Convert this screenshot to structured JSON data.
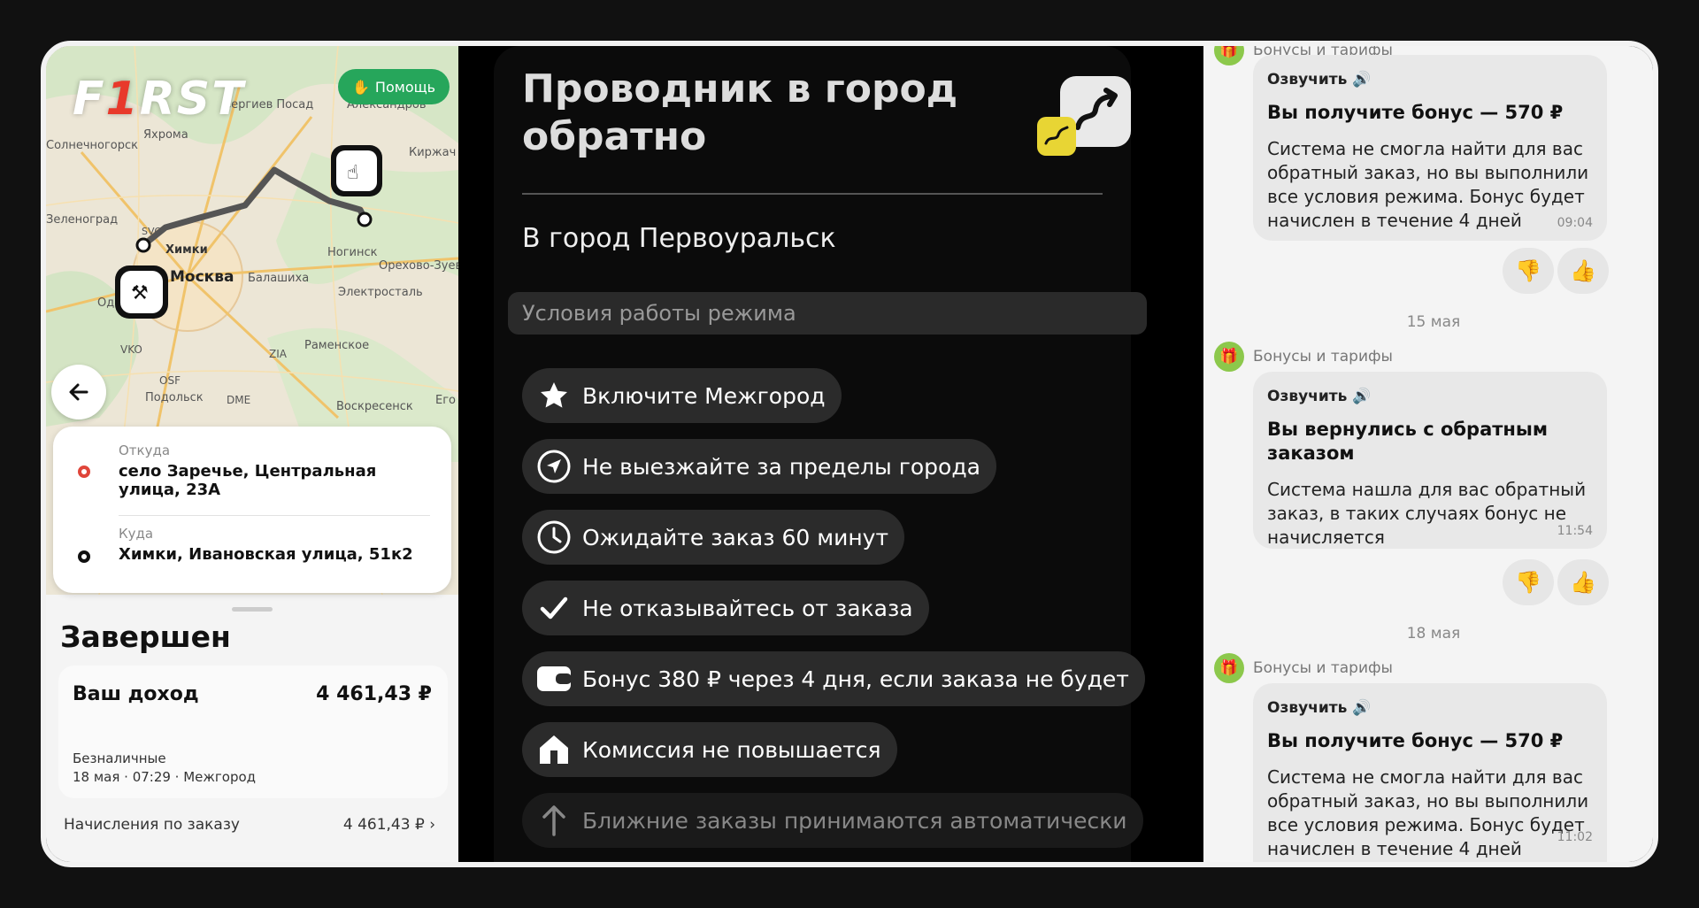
{
  "map": {
    "logo": {
      "pre": "F",
      "one": "1",
      "post": "RST"
    },
    "help_label": "Помощь",
    "places": [
      {
        "name": "Сергиев Посад"
      },
      {
        "name": "Александров"
      },
      {
        "name": "Яхрома"
      },
      {
        "name": "Киржач"
      },
      {
        "name": "Солнечногорск"
      },
      {
        "name": "Зеленоград"
      },
      {
        "name": "SVO"
      },
      {
        "name": "Химки"
      },
      {
        "name": "Ногинск"
      },
      {
        "name": "Орехово-Зуево"
      },
      {
        "name": "Москва"
      },
      {
        "name": "Балашиха"
      },
      {
        "name": "Электросталь"
      },
      {
        "name": "Од"
      },
      {
        "name": "VKO"
      },
      {
        "name": "ZIA"
      },
      {
        "name": "Раменское"
      },
      {
        "name": "OSF"
      },
      {
        "name": "Подольск"
      },
      {
        "name": "DME"
      },
      {
        "name": "Воскресенск"
      },
      {
        "name": "Его"
      }
    ]
  },
  "route": {
    "from_label": "Откуда",
    "from_value": "село Заречье, Центральная улица, 23А",
    "to_label": "Куда",
    "to_value": "Химки, Ивановская улица, 51к2"
  },
  "order": {
    "status": "Завершен",
    "income_label": "Ваш доход",
    "income_value": "4 461,43 ₽",
    "payment": "Безналичные",
    "meta": "18 мая · 07:29 · Межгород",
    "accruals_label": "Начисления по заказу",
    "accruals_value": "4 461,43 ₽"
  },
  "mode": {
    "title": "Проводник в город обратно",
    "city": "В город Первоуральск",
    "conditions_header": "Условия работы режима",
    "conditions": [
      {
        "icon": "star-icon",
        "text": "Включите Межгород"
      },
      {
        "icon": "navigation-arrow-icon",
        "text": "Не выезжайте за пределы города"
      },
      {
        "icon": "clock-icon",
        "text": "Ожидайте заказ 60 минут"
      },
      {
        "icon": "check-icon",
        "text": "Не отказывайтесь от заказа"
      },
      {
        "icon": "wallet-icon",
        "text": "Бонус 380 ₽ через 4 дня, если заказа не будет"
      },
      {
        "icon": "house-icon",
        "text": "Комиссия не повышается"
      },
      {
        "icon": "arrow-up-icon",
        "text": "Ближние заказы принимаются автоматически"
      }
    ]
  },
  "chat": {
    "top_sender": "Бонусы и тарифы",
    "messages": [
      {
        "voice": "Озвучить",
        "title": "Вы получите бонус — 570 ₽",
        "text": "Система не смогла найти для вас обратный заказ, но вы выполнили все условия режима. Бонус будет начислен в течение 4 дней",
        "time": "09:04"
      },
      {
        "date": "15 мая",
        "sender": "Бонусы и тарифы",
        "voice": "Озвучить",
        "title": "Вы вернулись с обратным заказом",
        "text": "Система нашла для вас обратный заказ, в таких случаях бонус не начисляется",
        "time": "11:54"
      },
      {
        "date": "18 мая",
        "sender": "Бонусы и тарифы",
        "voice": "Озвучить",
        "title": "Вы получите бонус — 570 ₽",
        "text": "Система не смогла найти для вас обратный заказ, но вы выполнили все условия режима. Бонус будет начислен в течение 4 дней",
        "time": "11:02"
      }
    ]
  },
  "colors": {
    "accent_yellow": "#e8d534",
    "help_green": "#26a65b",
    "logo_red": "#e8392b",
    "gift_green": "#8cc84b"
  }
}
